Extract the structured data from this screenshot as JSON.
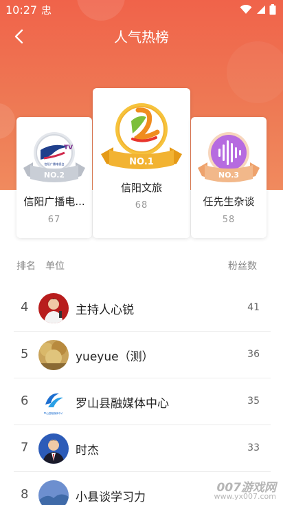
{
  "status_bar": {
    "time": "10:27",
    "carrier_glyph": "忠"
  },
  "nav": {
    "title": "人气热榜"
  },
  "podium": [
    {
      "rank_badge": "NO.2",
      "name": "信阳广播电...",
      "fans": "67",
      "logo_text": "信阳广播电视台"
    },
    {
      "rank_badge": "NO.1",
      "name": "信阳文旅",
      "fans": "68"
    },
    {
      "rank_badge": "NO.3",
      "name": "任先生杂谈",
      "fans": "58"
    }
  ],
  "list_header": {
    "rank": "排名",
    "unit": "单位",
    "fans": "粉丝数"
  },
  "rows": [
    {
      "rank": "4",
      "name": "主持人心锐",
      "fans": "41"
    },
    {
      "rank": "5",
      "name": "yueyue（测）",
      "fans": "36"
    },
    {
      "rank": "6",
      "name": "罗山县融媒体中心",
      "fans": "35",
      "logo_text": "罗山县融媒体中心"
    },
    {
      "rank": "7",
      "name": "时杰",
      "fans": "33"
    },
    {
      "rank": "8",
      "name": "小县谈学习力",
      "fans": ""
    }
  ],
  "colors": {
    "header_top": "#f0634a",
    "header_bottom": "#f08a5e",
    "gold": "#f2b332",
    "silver": "#c9ced6",
    "bronze": "#f2b88a"
  },
  "watermark": {
    "line1": "007游戏网",
    "line2": "www.yx007.com"
  }
}
